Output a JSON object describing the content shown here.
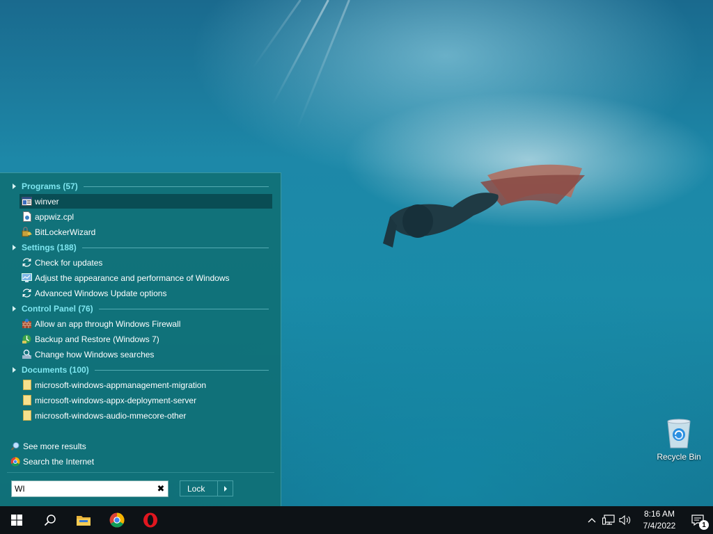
{
  "start_menu": {
    "sections": [
      {
        "label": "Programs (57)",
        "items": [
          {
            "label": "winver",
            "icon": "window-app-icon"
          },
          {
            "label": "appwiz.cpl",
            "icon": "control-panel-file-icon"
          },
          {
            "label": "BitLockerWizard",
            "icon": "bitlocker-key-icon"
          }
        ]
      },
      {
        "label": "Settings (188)",
        "items": [
          {
            "label": "Check for updates",
            "icon": "sync-icon"
          },
          {
            "label": "Adjust the appearance and performance of Windows",
            "icon": "monitor-performance-icon"
          },
          {
            "label": "Advanced Windows Update options",
            "icon": "sync-icon"
          }
        ]
      },
      {
        "label": "Control Panel (76)",
        "items": [
          {
            "label": "Allow an app through Windows Firewall",
            "icon": "firewall-icon"
          },
          {
            "label": "Backup and Restore (Windows 7)",
            "icon": "backup-icon"
          },
          {
            "label": "Change how Windows searches",
            "icon": "search-options-icon"
          }
        ]
      },
      {
        "label": "Documents (100)",
        "items": [
          {
            "label": "microsoft-windows-appmanagement-migration",
            "icon": "document-icon"
          },
          {
            "label": "microsoft-windows-appx-deployment-server",
            "icon": "document-icon"
          },
          {
            "label": "microsoft-windows-audio-mmecore-other",
            "icon": "document-icon"
          }
        ]
      }
    ],
    "see_more": "See more results",
    "search_internet": "Search the Internet",
    "search": {
      "value": "WI",
      "clear_icon": "close-icon"
    },
    "lock_label": "Lock"
  },
  "desktop": {
    "recycle_bin_label": "Recycle Bin"
  },
  "taskbar": {
    "pinned": [
      "windows-start-icon",
      "search-icon",
      "file-explorer-icon",
      "chrome-icon",
      "opera-icon"
    ],
    "tray": [
      "chevron-up-icon",
      "network-icon",
      "volume-icon"
    ],
    "time": "8:16 AM",
    "date": "7/4/2022",
    "notification_count": "1"
  },
  "colors": {
    "menu_bg": "#107076",
    "section_header": "#7ee6f0",
    "selected_row": "#08464e",
    "taskbar": "#0d1216"
  }
}
